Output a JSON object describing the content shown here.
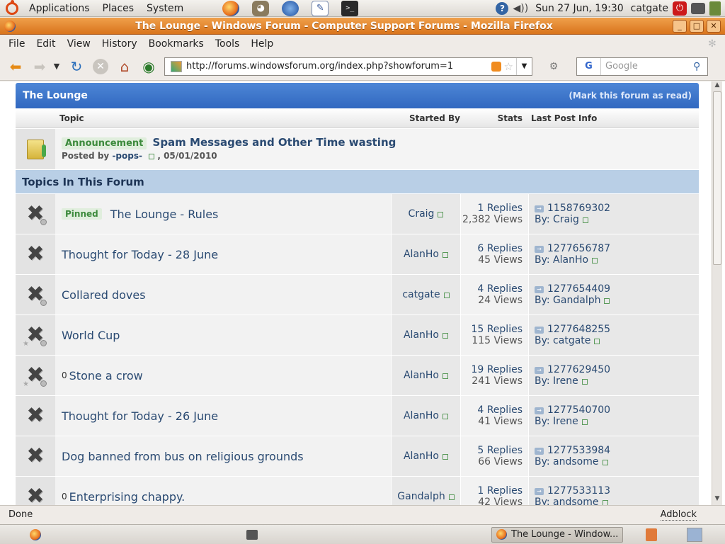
{
  "gnome_top": {
    "menus": [
      "Applications",
      "Places",
      "System"
    ],
    "clock": "Sun 27 Jun, 19:30",
    "user": "catgate"
  },
  "window": {
    "title": "The Lounge - Windows Forum - Computer Support Forums - Mozilla Firefox"
  },
  "menubar": {
    "file": "File",
    "edit": "Edit",
    "view": "View",
    "history": "History",
    "bookmarks": "Bookmarks",
    "tools": "Tools",
    "help": "Help"
  },
  "navbar": {
    "url": "http://forums.windowsforum.org/index.php?showforum=1",
    "search_engine": "G",
    "search_placeholder": "Google"
  },
  "forum": {
    "title": "The Lounge",
    "mark_read": "(Mark this forum as read)",
    "columns": {
      "topic": "Topic",
      "started_by": "Started By",
      "stats": "Stats",
      "last_post": "Last Post Info"
    },
    "announcement": {
      "badge": "Announcement",
      "title": "Spam Messages and Other Time wasting",
      "posted_by_label": "Posted by",
      "author": "-pops-",
      "date": ", 05/01/2010"
    },
    "topics_header": "Topics In This Forum",
    "topics": [
      {
        "pinned": "Pinned",
        "title": "The Lounge - Rules",
        "starter": "Craig",
        "replies": "1 Replies",
        "views": "2,382 Views",
        "last_id": "1158769302",
        "last_by": "Craig"
      },
      {
        "title": "Thought for Today - 28 June",
        "starter": "AlanHo",
        "replies": "6 Replies",
        "views": "45 Views",
        "last_id": "1277656787",
        "last_by": "AlanHo"
      },
      {
        "title": "Collared doves",
        "starter": "catgate",
        "replies": "4 Replies",
        "views": "24 Views",
        "last_id": "1277654409",
        "last_by": "Gandalph"
      },
      {
        "title": "World Cup",
        "starter": "AlanHo",
        "replies": "15 Replies",
        "views": "115 Views",
        "last_id": "1277648255",
        "last_by": "catgate"
      },
      {
        "attach": "0",
        "title": "Stone a crow",
        "starter": "AlanHo",
        "replies": "19 Replies",
        "views": "241 Views",
        "last_id": "1277629450",
        "last_by": "Irene"
      },
      {
        "title": "Thought for Today - 26 June",
        "starter": "AlanHo",
        "replies": "4 Replies",
        "views": "41 Views",
        "last_id": "1277540700",
        "last_by": "Irene"
      },
      {
        "title": "Dog banned from bus on religious grounds",
        "starter": "AlanHo",
        "replies": "5 Replies",
        "views": "66 Views",
        "last_id": "1277533984",
        "last_by": "andsome"
      },
      {
        "attach": "0",
        "title": "Enterprising chappy.",
        "starter": "Gandalph",
        "replies": "1 Replies",
        "views": "42 Views",
        "last_id": "1277533113",
        "last_by": "andsome"
      }
    ],
    "by_label": "By:"
  },
  "statusbar": {
    "status": "Done",
    "adblock": "Adblock"
  },
  "taskbar": {
    "task_label": "The Lounge - Window..."
  }
}
